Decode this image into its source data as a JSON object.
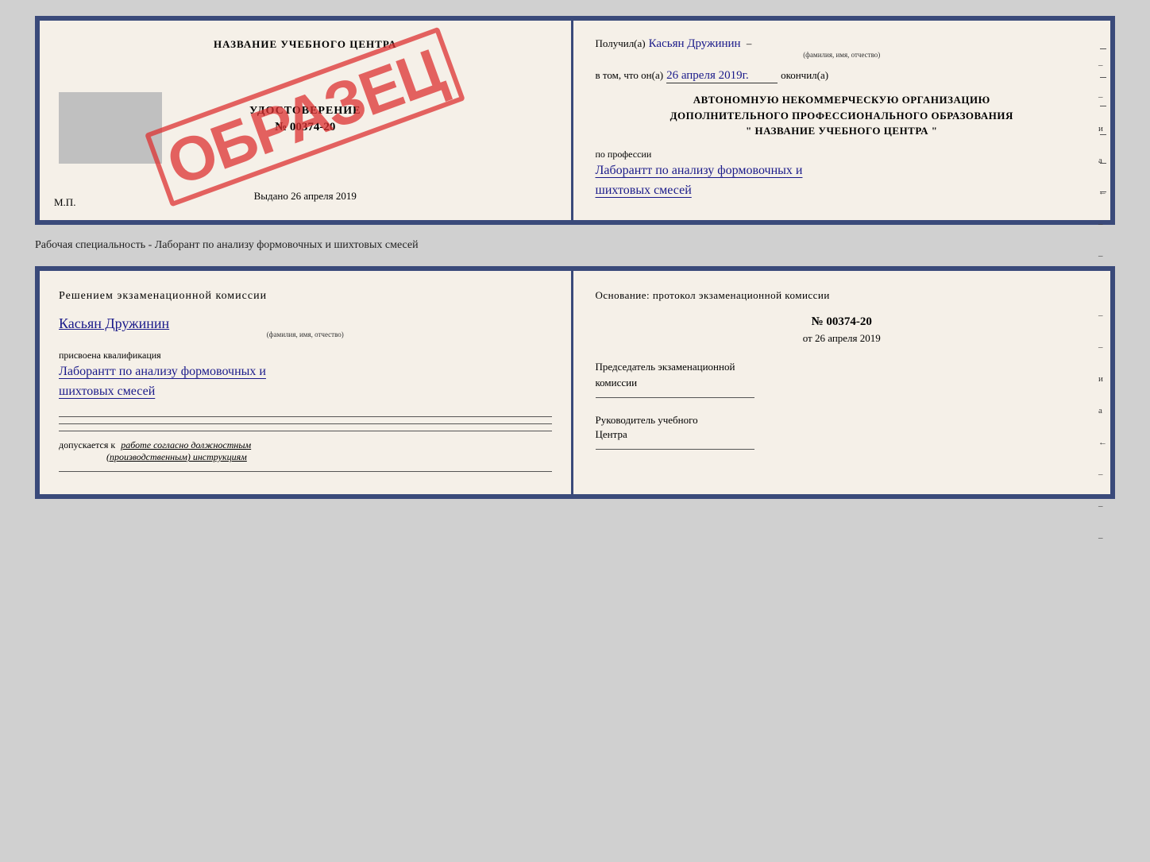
{
  "top_doc": {
    "left": {
      "title": "НАЗВАНИЕ УЧЕБНОГО ЦЕНТРА",
      "cert_label": "УДОСТОВЕРЕНИЕ",
      "cert_number": "№ 00374-20",
      "cert_issued": "Выдано  26 апреля 2019",
      "mp_label": "М.П.",
      "stamp_text": "ОБРАЗЕЦ"
    },
    "right": {
      "received_label": "Получил(а)",
      "recipient_name": "Касьян Дружинин",
      "recipient_subline": "(фамилия, имя, отчество)",
      "date_prefix": "в том, что он(а)",
      "date_value": "26 апреля 2019г.",
      "date_suffix": "окончил(а)",
      "block_line1": "АВТОНОМНУЮ НЕКОММЕРЧЕСКУЮ ОРГАНИЗАЦИЮ",
      "block_line2": "ДОПОЛНИТЕЛЬНОГО ПРОФЕССИОНАЛЬНОГО ОБРАЗОВАНИЯ",
      "block_line3": "\"   НАЗВАНИЕ УЧЕБНОГО ЦЕНТРА   \"",
      "profession_label": "по профессии",
      "profession_value_line1": "Лаборантт по анализу формовочных и",
      "profession_value_line2": "шихтовых смесей"
    }
  },
  "caption": "Рабочая специальность - Лаборант по анализу формовочных и шихтовых смесей",
  "bottom_doc": {
    "left": {
      "commission_text": "Решением  экзаменационной  комиссии",
      "name_value": "Касьян  Дружинин",
      "name_subline": "(фамилия, имя, отчество)",
      "qualification_label": "присвоена квалификация",
      "qualification_line1": "Лаборантт по анализу формовочных и",
      "qualification_line2": "шихтовых смесей",
      "admission_label": "допускается к",
      "admission_value": "работе согласно должностным",
      "admission_value2": "(производственным) инструкциям"
    },
    "right": {
      "basis_label": "Основание: протокол экзаменационной  комиссии",
      "protocol_number": "№  00374-20",
      "protocol_date_prefix": "от",
      "protocol_date_value": "26 апреля 2019",
      "chairman_label": "Председатель экзаменационной",
      "chairman_label2": "комиссии",
      "director_label": "Руководитель учебного",
      "director_label2": "Центра"
    }
  },
  "right_side_marks": [
    "–",
    "–",
    "и",
    "а",
    "←",
    "–",
    "–",
    "–"
  ]
}
